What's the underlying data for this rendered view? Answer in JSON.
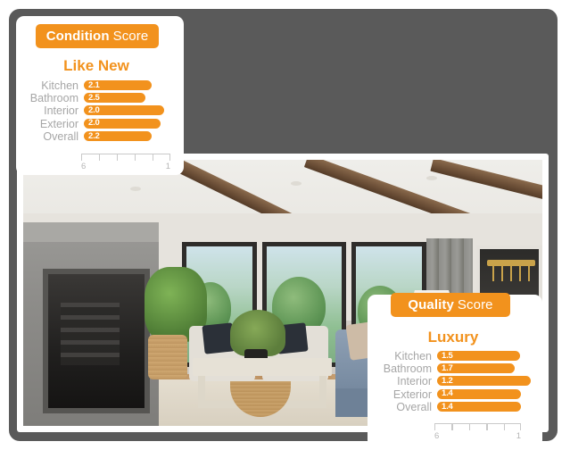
{
  "photo": {
    "alt": "modern living room interior with fireplace, large windows, blue sectional sofa and coffee table"
  },
  "cards": [
    {
      "id": "condition",
      "badge_bold": "Condition",
      "badge_light": "Score",
      "tier": "Like New",
      "rows": [
        {
          "label": "Kitchen",
          "value": "2.1",
          "bar_pct": 78
        },
        {
          "label": "Bathroom",
          "value": "2.5",
          "bar_pct": 70
        },
        {
          "label": "Interior",
          "value": "2.0",
          "bar_pct": 92
        },
        {
          "label": "Exterior",
          "value": "2.0",
          "bar_pct": 88
        },
        {
          "label": "Overall",
          "value": "2.2",
          "bar_pct": 78
        }
      ],
      "axis": {
        "low": "6",
        "high": "1",
        "ticks": 6
      }
    },
    {
      "id": "quality",
      "badge_bold": "Quality",
      "badge_light": "Score",
      "tier": "Luxury",
      "rows": [
        {
          "label": "Kitchen",
          "value": "1.5",
          "bar_pct": 88
        },
        {
          "label": "Bathroom",
          "value": "1.7",
          "bar_pct": 82
        },
        {
          "label": "Interior",
          "value": "1.2",
          "bar_pct": 99
        },
        {
          "label": "Exterior",
          "value": "1.4",
          "bar_pct": 89
        },
        {
          "label": "Overall",
          "value": "1.4",
          "bar_pct": 89
        }
      ],
      "axis": {
        "low": "6",
        "high": "1",
        "ticks": 6
      }
    }
  ],
  "colors": {
    "accent": "#F2921D",
    "label_grey": "#A6A6A6",
    "axis_grey": "#C9C9C9",
    "shadow": "#5A5A5A",
    "card_bg": "#FFFFFF"
  },
  "chart_data": [
    {
      "type": "bar",
      "title": "Condition Score",
      "subtitle": "Like New",
      "categories": [
        "Kitchen",
        "Bathroom",
        "Interior",
        "Exterior",
        "Overall"
      ],
      "values": [
        2.1,
        2.5,
        2.0,
        2.0,
        2.2
      ],
      "xlabel": "",
      "ylabel": "",
      "xlim": [
        6,
        1
      ],
      "axis_tick_labels": [
        "6",
        "1"
      ],
      "grid": false,
      "orientation": "horizontal",
      "legend": "none",
      "note": "axis is reversed: 6 at left, 1 at right (lower score = better)"
    },
    {
      "type": "bar",
      "title": "Quality Score",
      "subtitle": "Luxury",
      "categories": [
        "Kitchen",
        "Bathroom",
        "Interior",
        "Exterior",
        "Overall"
      ],
      "values": [
        1.5,
        1.7,
        1.2,
        1.4,
        1.4
      ],
      "xlabel": "",
      "ylabel": "",
      "xlim": [
        6,
        1
      ],
      "axis_tick_labels": [
        "6",
        "1"
      ],
      "grid": false,
      "orientation": "horizontal",
      "legend": "none",
      "note": "axis is reversed: 6 at left, 1 at right (lower score = better)"
    }
  ]
}
